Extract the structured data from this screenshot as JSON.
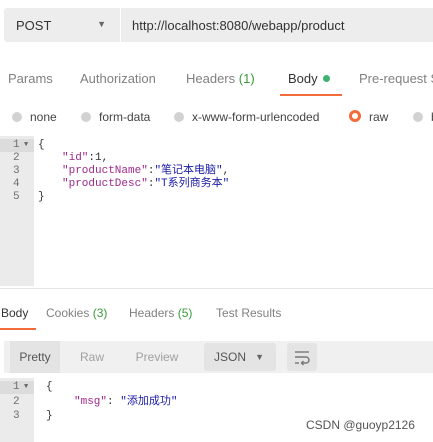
{
  "request": {
    "method": "POST",
    "url": "http://localhost:8080/webapp/product"
  },
  "request_tabs": [
    {
      "label": "Params"
    },
    {
      "label": "Authorization"
    },
    {
      "label": "Headers",
      "count": "(1)"
    },
    {
      "label": "Body"
    },
    {
      "label": "Pre-request S"
    }
  ],
  "body_types": [
    "none",
    "form-data",
    "x-www-form-urlencoded",
    "raw",
    "b"
  ],
  "body_types_selected": "raw",
  "request_body": {
    "line_numbers": [
      "1",
      "2",
      "3",
      "4",
      "5"
    ],
    "lines": [
      {
        "text": "{"
      },
      {
        "key": "\"id\"",
        "sep": ":1,"
      },
      {
        "key": "\"productName\"",
        "sep": ":",
        "value": "\"笔记本电脑\"",
        "tail": ","
      },
      {
        "key": "\"productDesc\"",
        "sep": ":",
        "value": "\"T系列商务本\""
      },
      {
        "text": "}"
      }
    ]
  },
  "response_tabs": [
    {
      "label": "Body"
    },
    {
      "label": "Cookies",
      "count": "(3)"
    },
    {
      "label": "Headers",
      "count": "(5)"
    },
    {
      "label": "Test Results"
    }
  ],
  "response_toolbar": {
    "pretty": "Pretty",
    "raw": "Raw",
    "preview": "Preview",
    "language": "JSON"
  },
  "response_body": {
    "line_numbers": [
      "1",
      "2",
      "3"
    ],
    "lines": [
      {
        "text": "{"
      },
      {
        "key": "\"msg\"",
        "sep": ": ",
        "value": "\"添加成功\""
      },
      {
        "text": "}"
      }
    ]
  },
  "watermark": "CSDN @guoyp2126",
  "colors": {
    "accent": "#f26b3a",
    "count_green": "#3a9a3a",
    "body_dot": "#3cb371",
    "json_key": "#a0288c",
    "json_string": "#1a1aa6",
    "editor_gutter": "#ebebeb"
  }
}
